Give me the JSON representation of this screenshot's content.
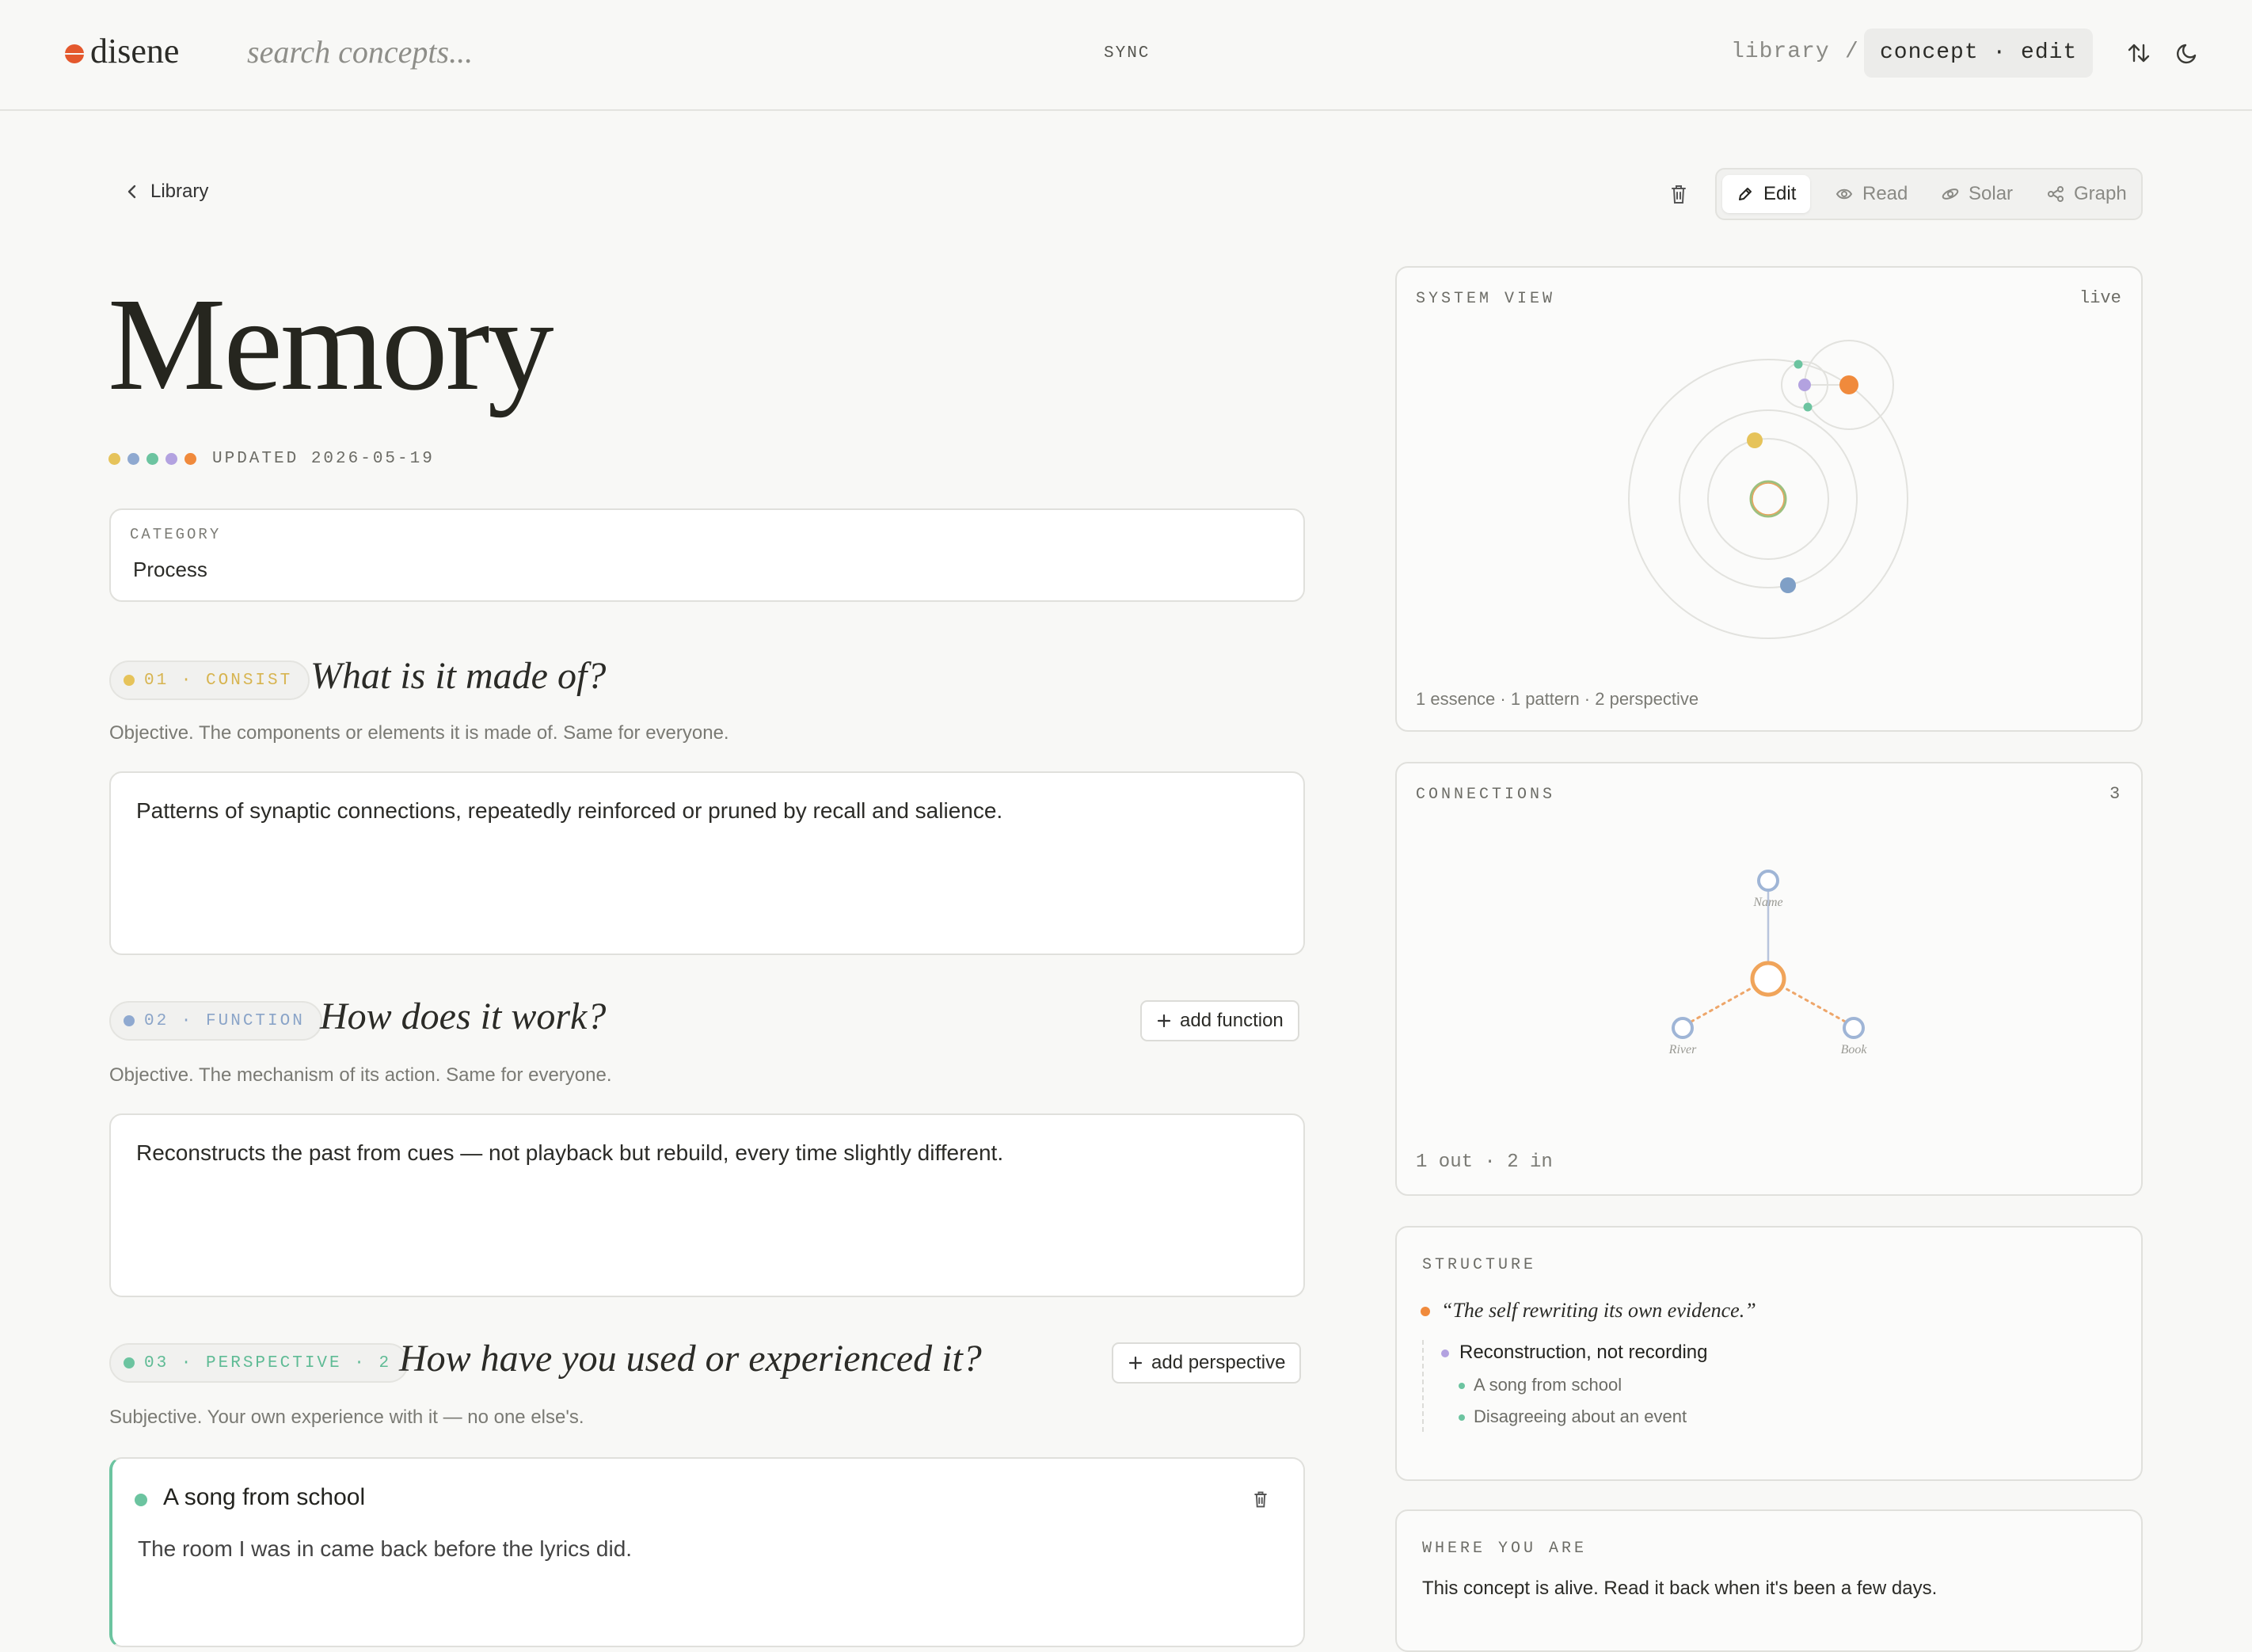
{
  "header": {
    "logo": "disene",
    "search_placeholder": "search concepts...",
    "sync_label": "SYNC",
    "breadcrumb": {
      "library": "library",
      "separator": "/",
      "current": "concept · edit"
    },
    "icons": [
      "sort-icon",
      "moon-icon"
    ]
  },
  "toolbar": {
    "back_label": "Library",
    "view_tabs": [
      {
        "label": "Edit",
        "icon": "pencil-icon",
        "active": true
      },
      {
        "label": "Read",
        "icon": "eye-icon",
        "active": false
      },
      {
        "label": "Solar",
        "icon": "orbit-icon",
        "active": false
      },
      {
        "label": "Graph",
        "icon": "graph-icon",
        "active": false
      }
    ]
  },
  "concept": {
    "title": "Memory",
    "updated": "UPDATED 2026-05-19",
    "status_colors": [
      "#e6c35a",
      "#8fa9d0",
      "#6cc4a0",
      "#b3a2e0",
      "#f08a3c"
    ],
    "category": {
      "label": "CATEGORY",
      "value": "Process"
    }
  },
  "sections": {
    "consist": {
      "tag": "01 · CONSIST",
      "color": "#e6c35a",
      "question": "What is it made of?",
      "description": "Objective. The components or elements it is made of. Same for everyone.",
      "answer": "Patterns of synaptic connections, repeatedly reinforced or pruned by recall and salience."
    },
    "function": {
      "tag": "02 · FUNCTION",
      "color": "#8fa9d0",
      "question": "How does it work?",
      "add_label": "add function",
      "description": "Objective. The mechanism of its action. Same for everyone.",
      "answer": "Reconstructs the past from cues — not playback but rebuild, every time slightly different."
    },
    "perspective": {
      "tag": "03 · PERSPECTIVE · 2",
      "color": "#6cc4a0",
      "question": "How have you used or experienced it?",
      "add_label": "add perspective",
      "description": "Subjective. Your own experience with it — no one else's.",
      "items": [
        {
          "title": "A song from school",
          "body": "The room I was in came back before the lyrics did."
        }
      ]
    }
  },
  "panels": {
    "system_view": {
      "title": "SYSTEM VIEW",
      "badge": "live",
      "summary": "1 essence · 1 pattern · 2 perspective"
    },
    "connections": {
      "title": "CONNECTIONS",
      "count": "3",
      "nodes": [
        "Name",
        "River",
        "Book"
      ],
      "summary": "1 out · 2 in"
    },
    "structure": {
      "title": "STRUCTURE",
      "essence": "“The self rewriting its own evidence.”",
      "pattern": "Reconstruction, not recording",
      "perspectives": [
        "A song from school",
        "Disagreeing about an event"
      ]
    },
    "where_you_are": {
      "title": "WHERE YOU ARE",
      "text": "This concept is alive. Read it back when it's been a few days."
    }
  }
}
